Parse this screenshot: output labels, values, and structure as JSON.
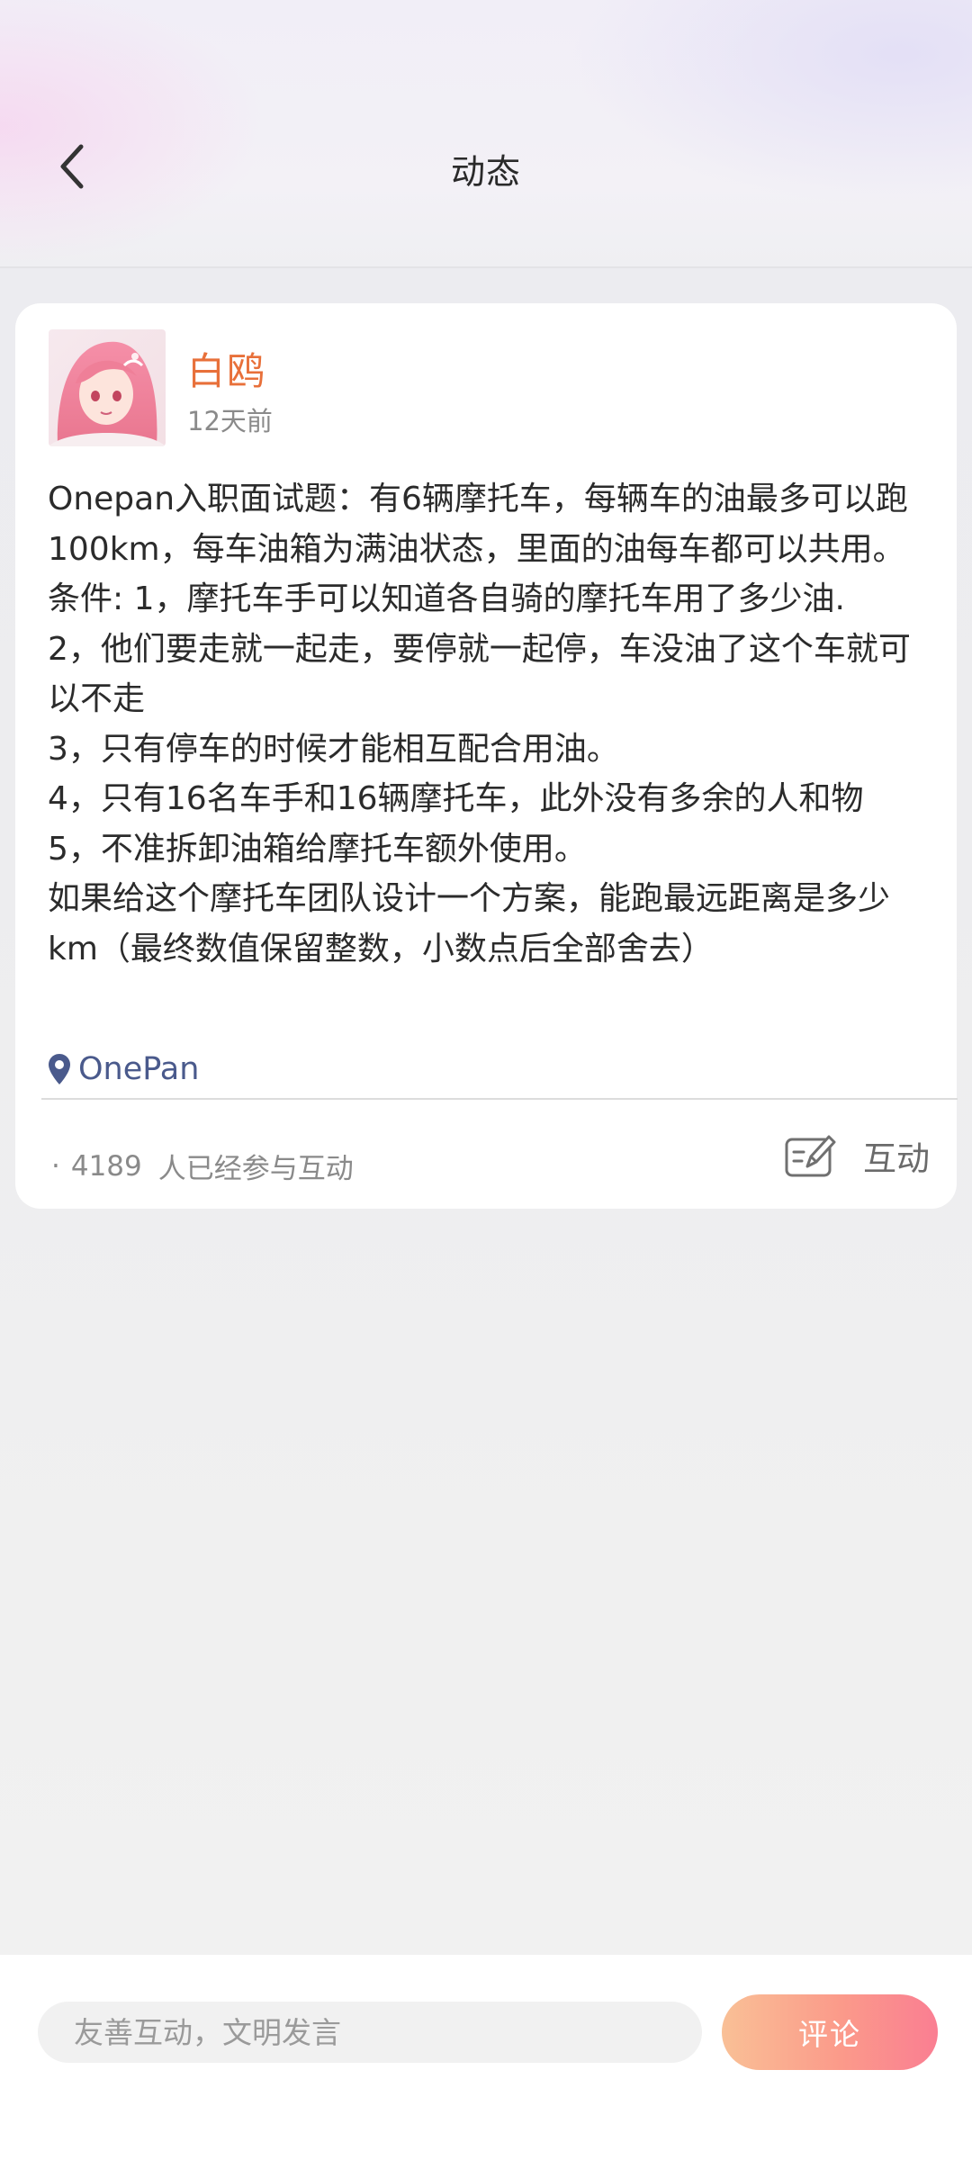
{
  "header": {
    "title": "动态",
    "back_icon": "chevron-left-icon"
  },
  "post": {
    "author": {
      "name": "白鸥",
      "avatar": "anime-avatar"
    },
    "time_ago": "12天前",
    "lines": [
      "Onepan入职面试题：有6辆摩托车，每辆车的油最多可以跑100km，每车油箱为满油状态，里面的油每车都可以共用。",
      "条件: 1，摩托车手可以知道各自骑的摩托车用了多少油.",
      "2，他们要走就一起走，要停就一起停，车没油了这个车就可以不走",
      "3，只有停车的时候才能相互配合用油。",
      "4，只有16名车手和16辆摩托车，此外没有多余的人和物",
      "5，不准拆卸油箱给摩托车额外使用。",
      "如果给这个摩托车团队设计一个方案，能跑最远距离是多少km（最终数值保留整数，小数点后全部舍去）"
    ],
    "location": "OnePan",
    "location_icon": "map-pin-icon",
    "participants_dot": "·",
    "participants_count": "4189",
    "participants_label": "人已经参与互动",
    "interact_label": "互动",
    "interact_icon": "edit-note-icon"
  },
  "bottom_bar": {
    "input_placeholder": "友善互动，文明发言",
    "input_value": "",
    "submit_label": "评论"
  },
  "colors": {
    "author_name": "#e8703a",
    "location": "#4a5a8c",
    "button_gradient_start": "#f9c096",
    "button_gradient_end": "#fa7e92"
  }
}
